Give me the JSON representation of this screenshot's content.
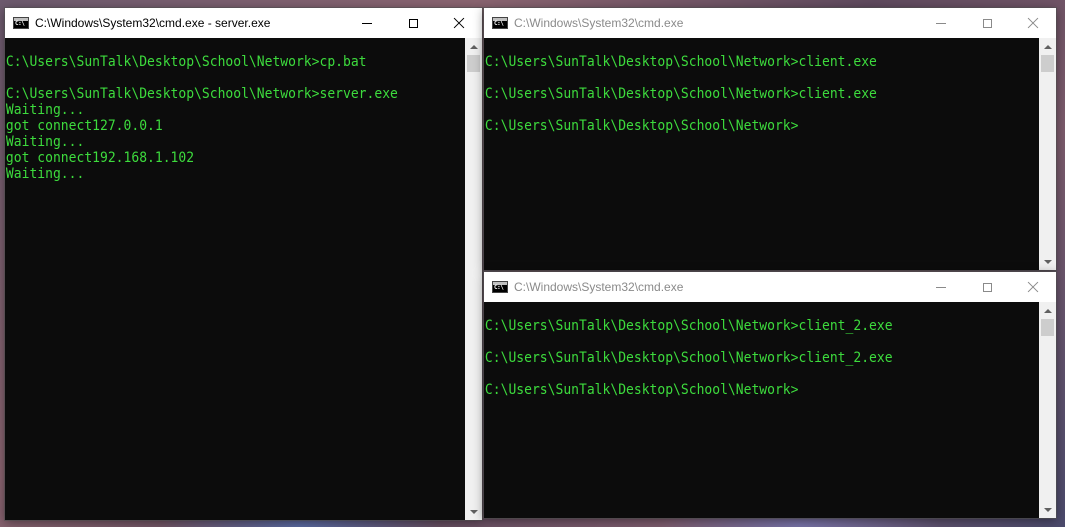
{
  "windows": [
    {
      "title": "C:\\Windows\\System32\\cmd.exe - server.exe",
      "active": true,
      "lines": [
        "",
        "C:\\Users\\SunTalk\\Desktop\\School\\Network>cp.bat",
        "",
        "C:\\Users\\SunTalk\\Desktop\\School\\Network>server.exe",
        "Waiting...",
        "got connect127.0.0.1",
        "Waiting...",
        "got connect192.168.1.102",
        "Waiting..."
      ]
    },
    {
      "title": "C:\\Windows\\System32\\cmd.exe",
      "active": false,
      "lines": [
        "",
        "C:\\Users\\SunTalk\\Desktop\\School\\Network>client.exe",
        "",
        "C:\\Users\\SunTalk\\Desktop\\School\\Network>client.exe",
        "",
        "C:\\Users\\SunTalk\\Desktop\\School\\Network>"
      ]
    },
    {
      "title": "C:\\Windows\\System32\\cmd.exe",
      "active": false,
      "lines": [
        "",
        "C:\\Users\\SunTalk\\Desktop\\School\\Network>client_2.exe",
        "",
        "C:\\Users\\SunTalk\\Desktop\\School\\Network>client_2.exe",
        "",
        "C:\\Users\\SunTalk\\Desktop\\School\\Network>"
      ]
    }
  ],
  "colors": {
    "console_text": "#3ddb3d",
    "console_background": "#0c0c0c",
    "titlebar_background": "#ffffff"
  },
  "icons": {
    "window_app": "cmd-icon",
    "minimize": "minimize-icon",
    "maximize": "maximize-icon",
    "close": "close-icon"
  }
}
